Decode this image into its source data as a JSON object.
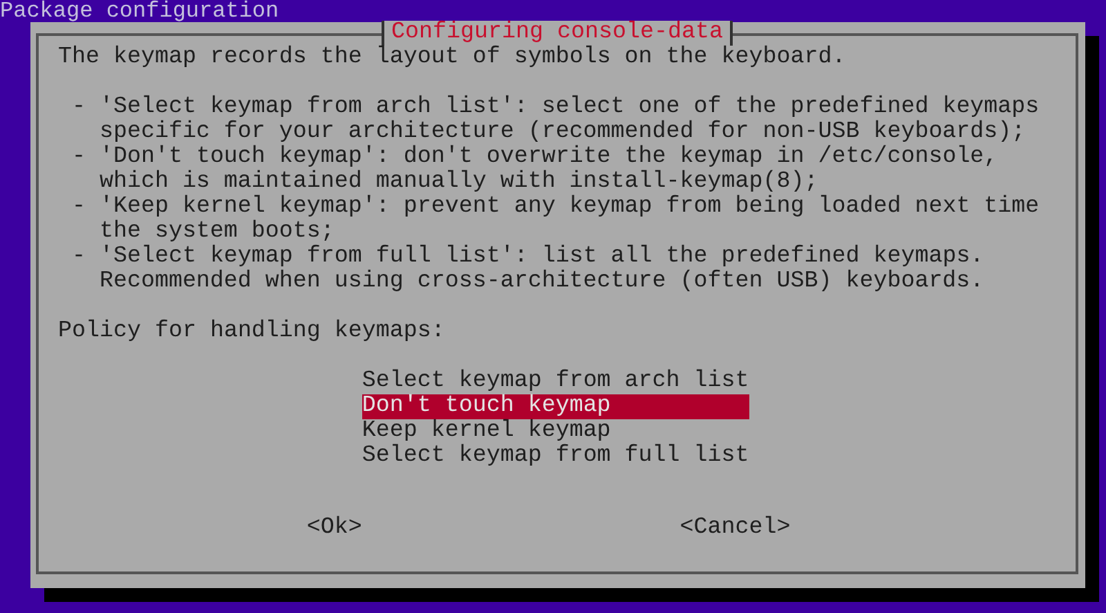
{
  "backtitle": "Package configuration",
  "dialog": {
    "title": "Configuring console-data",
    "intro": "The keymap records the layout of symbols on the keyboard.",
    "bullets": [
      "- 'Select keymap from arch list': select one of the predefined keymaps specific for your architecture (recommended for non-USB keyboards);",
      "- 'Don't touch keymap': don't overwrite the keymap in /etc/console, which is maintained manually with install-keymap(8);",
      "- 'Keep kernel keymap': prevent any keymap from being loaded next time the system boots;",
      "- 'Select keymap from full list': list all the predefined keymaps. Recommended when using cross-architecture (often USB) keyboards."
    ],
    "prompt": "Policy for handling keymaps:",
    "options": [
      {
        "label": "Select keymap from arch list",
        "selected": false
      },
      {
        "label": "Don't touch keymap",
        "selected": true
      },
      {
        "label": "Keep kernel keymap",
        "selected": false
      },
      {
        "label": "Select keymap from full list",
        "selected": false
      }
    ],
    "buttons": [
      {
        "label": "<Ok>"
      },
      {
        "label": "<Cancel>"
      }
    ]
  }
}
